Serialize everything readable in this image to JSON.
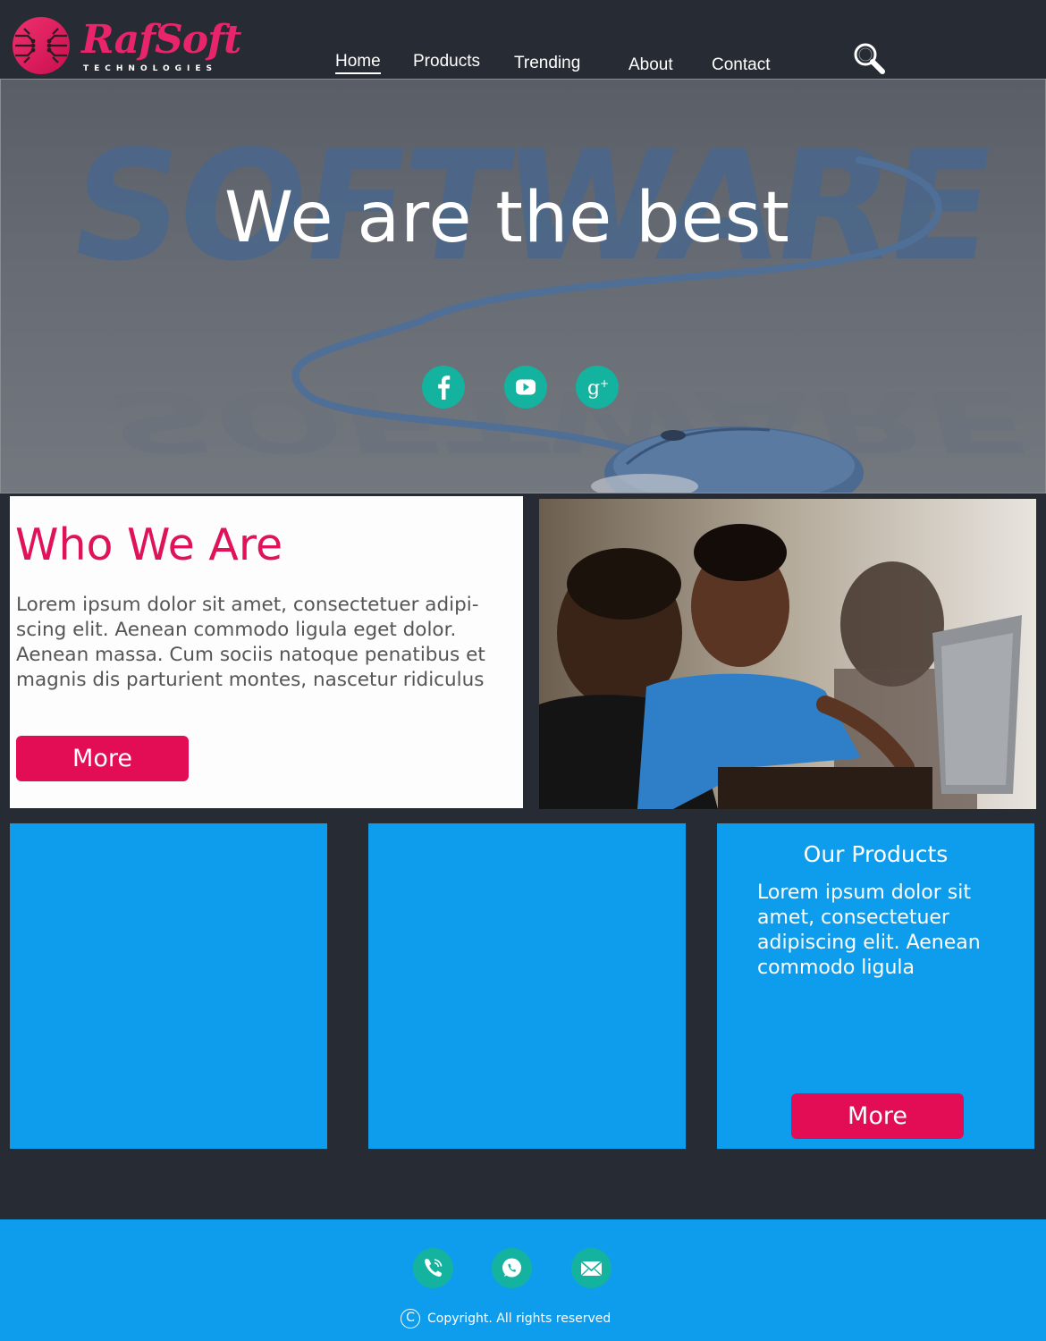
{
  "brand": {
    "name": "RafSoft",
    "tagline": "TECHNOLOGIES",
    "accent": "#e8246b"
  },
  "nav": {
    "items": [
      {
        "label": "Home",
        "active": true
      },
      {
        "label": "Products",
        "active": false
      },
      {
        "label": "Trending",
        "active": false
      },
      {
        "label": "About",
        "active": false
      },
      {
        "label": "Contact",
        "active": false
      }
    ],
    "search_icon": "magnifier-icon"
  },
  "hero": {
    "title": "We are the best",
    "background_word": "SOFTWARE",
    "social": [
      "facebook-icon",
      "youtube-icon",
      "google-plus-icon"
    ]
  },
  "who": {
    "title": "Who We Are",
    "text": "Lorem ipsum dolor sit amet, consectetuer adipi-scing elit. Aenean commodo ligula eget dolor. Aenean massa. Cum sociis natoque penatibus et magnis dis parturient montes, nascetur ridiculus",
    "button": "More"
  },
  "products": {
    "title": "Our Products",
    "text": "Lorem ipsum dolor sit amet, consectetuer adipiscing elit. Aenean commodo ligula",
    "button": "More"
  },
  "footer": {
    "icons": [
      "phone-icon",
      "whatsapp-icon",
      "mail-icon"
    ],
    "copyright": "Copyright. All rights reserved"
  },
  "colors": {
    "header_bg": "#272b33",
    "pink": "#e30d55",
    "blue": "#0e9ded",
    "teal": "#14b39f"
  }
}
